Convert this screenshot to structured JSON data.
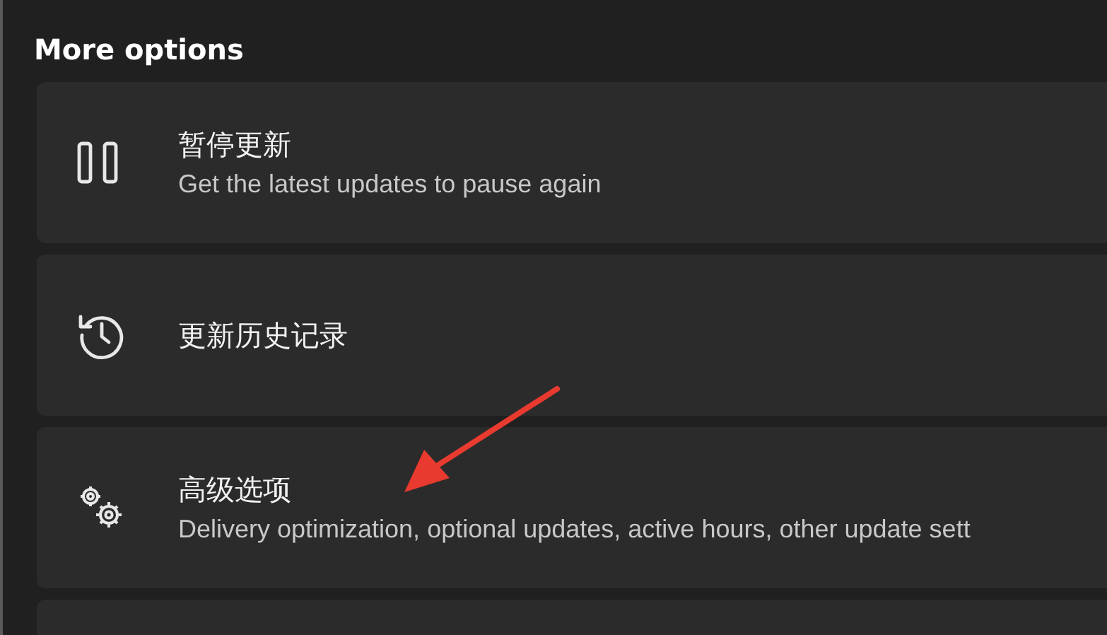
{
  "section_title": "More options",
  "items": [
    {
      "kind": "pause",
      "title": "暂停更新",
      "description": "Get the latest updates to pause again"
    },
    {
      "kind": "history",
      "title": "更新历史记录"
    },
    {
      "kind": "advanced",
      "title": "高级选项",
      "description": "Delivery optimization, optional updates, active hours, other update sett"
    },
    {
      "kind": "empty"
    }
  ],
  "annotation": {
    "kind": "arrow"
  }
}
